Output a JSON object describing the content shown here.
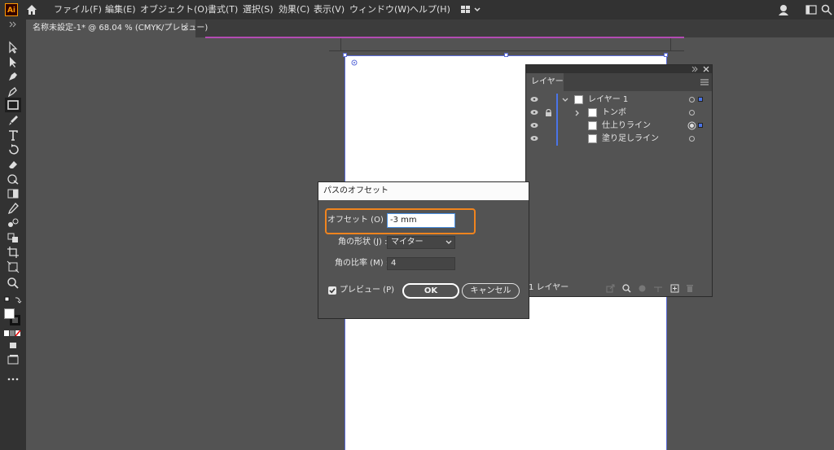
{
  "app": {
    "logo_text": "Ai"
  },
  "menu": {
    "items": [
      "ファイル(F)",
      "編集(E)",
      "オブジェクト(O)",
      "書式(T)",
      "選択(S)",
      "効果(C)",
      "表示(V)",
      "ウィンドウ(W)",
      "ヘルプ(H)"
    ]
  },
  "document": {
    "tab_label": "名称未設定-1* @ 68.04 % (CMYK/プレビュー)",
    "close_glyph": "×"
  },
  "layers_panel": {
    "tab_label": "レイヤー",
    "rows": [
      {
        "name": "レイヤー 1",
        "locked": false,
        "expanded": true,
        "selected": false
      },
      {
        "name": "トンボ",
        "locked": true,
        "expanded": false,
        "selected": false
      },
      {
        "name": "仕上りライン",
        "locked": false,
        "expanded": false,
        "selected": true
      },
      {
        "name": "塗り足しライン",
        "locked": false,
        "expanded": false,
        "selected": false
      }
    ],
    "footer_count": "1 レイヤー"
  },
  "dialog": {
    "title": "パスのオフセット",
    "offset_label": "オフセット (O) :",
    "offset_value": "-3 mm",
    "corner_label": "角の形状 (J) :",
    "corner_value": "マイター",
    "miter_label": "角の比率 (M) :",
    "miter_value": "4",
    "preview_label": "プレビュー (P)",
    "preview_checked": true,
    "ok_label": "OK",
    "cancel_label": "キャンセル"
  },
  "colors": {
    "accent": "#f0841e",
    "selection": "#4a74e8",
    "artboard_border": "#5b6bd8"
  }
}
